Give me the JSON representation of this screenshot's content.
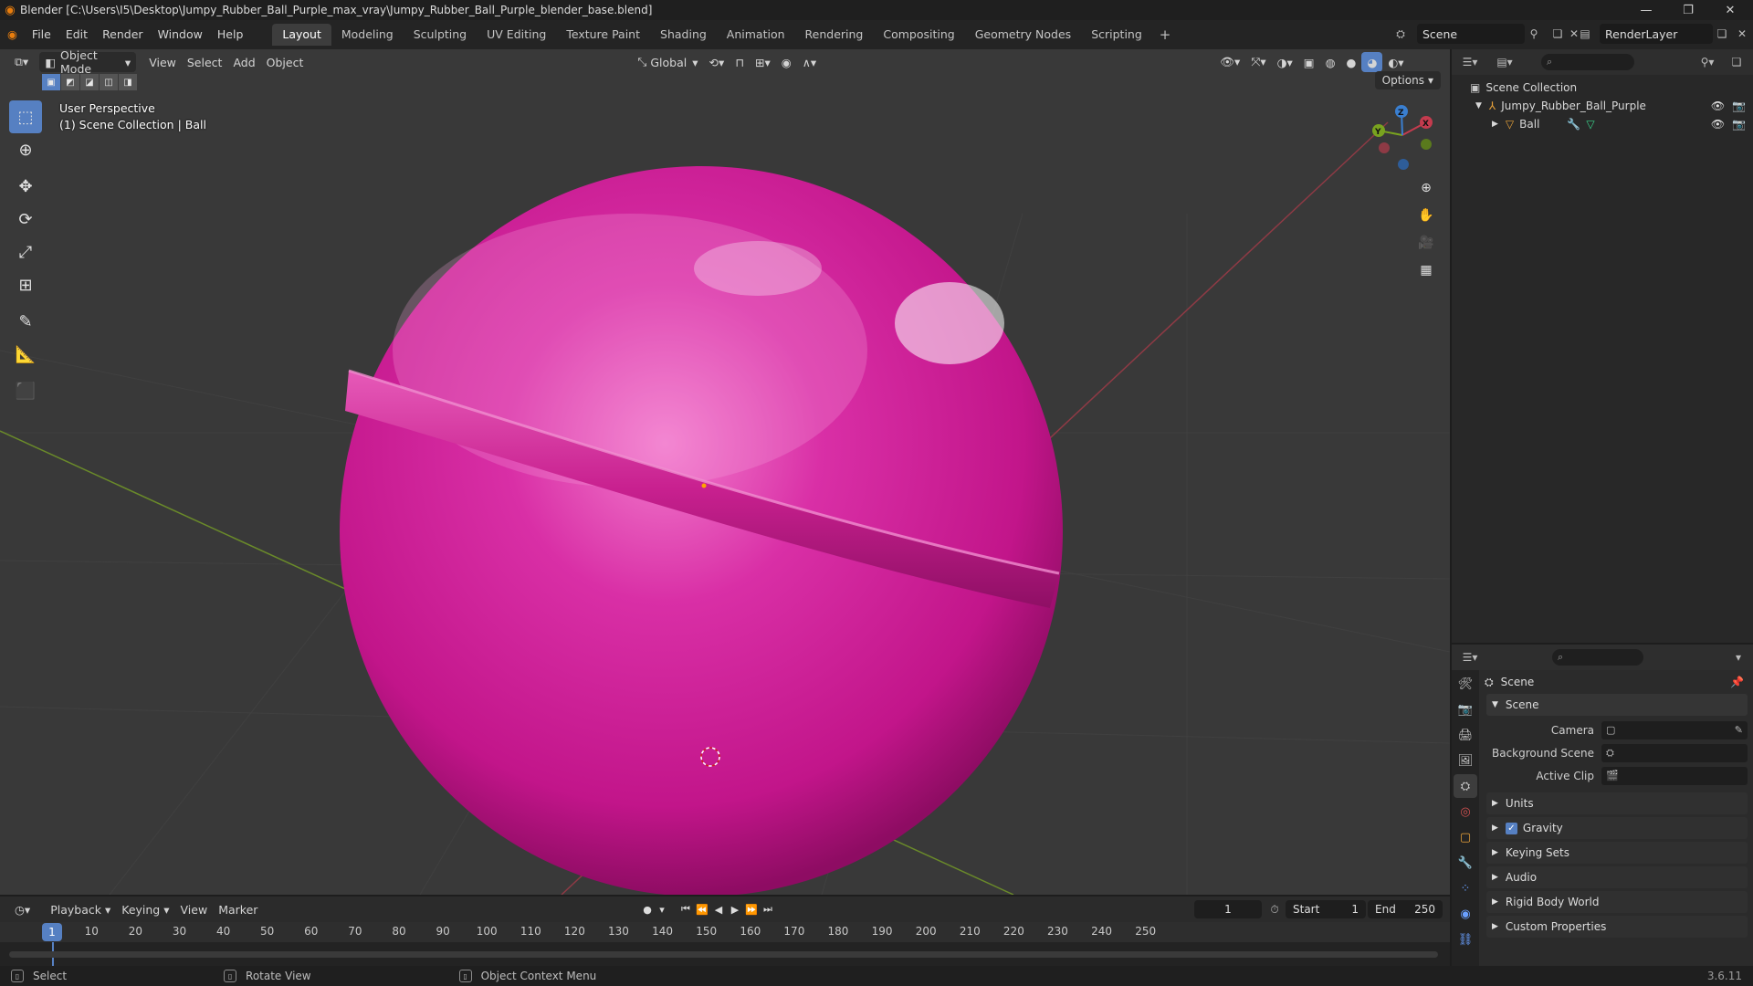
{
  "window": {
    "title": "Blender [C:\\Users\\I5\\Desktop\\Jumpy_Rubber_Ball_Purple_max_vray\\Jumpy_Rubber_Ball_Purple_blender_base.blend]",
    "min_icon": "minimize-icon",
    "max_icon": "maximize-icon",
    "close_icon": "close-icon"
  },
  "menu": [
    "File",
    "Edit",
    "Render",
    "Window",
    "Help"
  ],
  "workspaces": [
    {
      "label": "Layout",
      "active": true
    },
    {
      "label": "Modeling",
      "active": false
    },
    {
      "label": "Sculpting",
      "active": false
    },
    {
      "label": "UV Editing",
      "active": false
    },
    {
      "label": "Texture Paint",
      "active": false
    },
    {
      "label": "Shading",
      "active": false
    },
    {
      "label": "Animation",
      "active": false
    },
    {
      "label": "Rendering",
      "active": false
    },
    {
      "label": "Compositing",
      "active": false
    },
    {
      "label": "Geometry Nodes",
      "active": false
    },
    {
      "label": "Scripting",
      "active": false
    }
  ],
  "workspace_add": "+",
  "scene_selector": "Scene",
  "view_layer": "RenderLayer",
  "viewport": {
    "mode": "Object Mode",
    "menus": [
      "View",
      "Select",
      "Add",
      "Object"
    ],
    "orientation": "Global",
    "info_line1": "User Perspective",
    "info_line2": "(1) Scene Collection | Ball",
    "options": "Options",
    "gizmo": {
      "x": "X",
      "y": "Y",
      "z": "Z"
    }
  },
  "outliner": {
    "root": "Scene Collection",
    "items": [
      {
        "name": "Jumpy_Rubber_Ball_Purple",
        "icon": "empty-icon"
      },
      {
        "name": "Ball",
        "icon": "mesh-icon"
      }
    ]
  },
  "properties": {
    "context": "Scene",
    "section": "Scene",
    "fields": [
      {
        "label": "Camera",
        "value": ""
      },
      {
        "label": "Background Scene",
        "value": ""
      },
      {
        "label": "Active Clip",
        "value": ""
      }
    ],
    "collapsed": [
      "Units",
      "Gravity",
      "Keying Sets",
      "Audio",
      "Rigid Body World",
      "Custom Properties"
    ],
    "gravity_checked": true
  },
  "timeline": {
    "menus": [
      "Playback",
      "Keying",
      "View",
      "Marker"
    ],
    "current_frame": "1",
    "start_label": "Start",
    "start": "1",
    "end_label": "End",
    "end": "250",
    "ruler": [
      1,
      10,
      20,
      30,
      40,
      50,
      60,
      70,
      80,
      90,
      100,
      110,
      120,
      130,
      140,
      150,
      160,
      170,
      180,
      190,
      200,
      210,
      220,
      230,
      240,
      250
    ]
  },
  "status": {
    "items": [
      "Select",
      "Rotate View",
      "Object Context Menu"
    ],
    "version": "3.6.11"
  },
  "colors": {
    "accent": "#5680c2",
    "ball": "#d5209a",
    "x_axis": "#c43b4e",
    "y_axis": "#79a31f",
    "z_axis": "#3a7fd0"
  }
}
